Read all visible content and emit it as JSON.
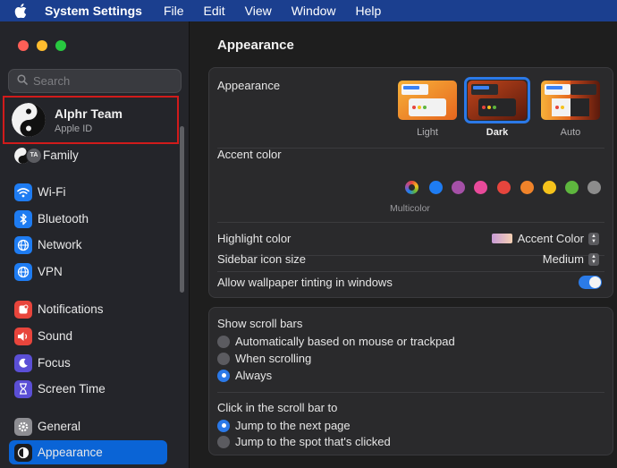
{
  "menubar": {
    "app_name": "System Settings",
    "items": [
      "File",
      "Edit",
      "View",
      "Window",
      "Help"
    ]
  },
  "sidebar": {
    "search_placeholder": "Search",
    "profile": {
      "name": "Alphr Team",
      "subtitle": "Apple ID"
    },
    "family": {
      "label": "Family",
      "initials": "TA"
    },
    "items": [
      {
        "label": "Wi-Fi",
        "icon": "wifi-icon",
        "color": "#1e7cf2"
      },
      {
        "label": "Bluetooth",
        "icon": "bluetooth-icon",
        "color": "#1e7cf2"
      },
      {
        "label": "Network",
        "icon": "globe-icon",
        "color": "#1e7cf2"
      },
      {
        "label": "VPN",
        "icon": "globe-icon",
        "color": "#1e7cf2"
      },
      {
        "label": "Notifications",
        "icon": "bell-icon",
        "color": "#e8453c"
      },
      {
        "label": "Sound",
        "icon": "speaker-icon",
        "color": "#e8453c"
      },
      {
        "label": "Focus",
        "icon": "moon-icon",
        "color": "#5b4fd6"
      },
      {
        "label": "Screen Time",
        "icon": "hourglass-icon",
        "color": "#5b4fd6"
      },
      {
        "label": "General",
        "icon": "gear-icon",
        "color": "#8e8e93"
      },
      {
        "label": "Appearance",
        "icon": "appearance-icon",
        "color": "#1c1c1e"
      }
    ],
    "active": "Appearance"
  },
  "main": {
    "title": "Appearance",
    "appearance": {
      "label": "Appearance",
      "options": [
        "Light",
        "Dark",
        "Auto"
      ],
      "selected": "Dark"
    },
    "accent": {
      "label": "Accent color",
      "caption": "Multicolor",
      "colors": [
        "#1e7cf2",
        "#a550a7",
        "#e84a9a",
        "#e6453d",
        "#f0832a",
        "#f5c21b",
        "#5eb63e",
        "#8c8c8c"
      ]
    },
    "highlight": {
      "label": "Highlight color",
      "value": "Accent Color"
    },
    "sidebar_icon": {
      "label": "Sidebar icon size",
      "value": "Medium"
    },
    "wallpaper_tint": {
      "label": "Allow wallpaper tinting in windows",
      "on": true
    },
    "scroll_bars": {
      "title": "Show scroll bars",
      "options": [
        "Automatically based on mouse or trackpad",
        "When scrolling",
        "Always"
      ],
      "selected": "Always"
    },
    "click_scroll": {
      "title": "Click in the scroll bar to",
      "options": [
        "Jump to the next page",
        "Jump to the spot that's clicked"
      ],
      "selected": "Jump to the next page"
    }
  }
}
